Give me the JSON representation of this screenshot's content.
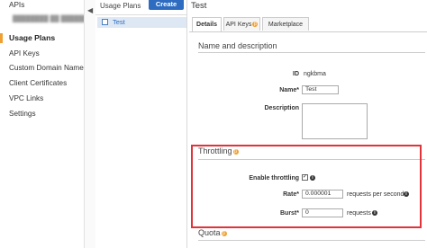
{
  "sidebar": {
    "items": [
      {
        "label": "APIs"
      },
      {
        "label": "Usage Plans"
      },
      {
        "label": "API Keys"
      },
      {
        "label": "Custom Domain Names"
      },
      {
        "label": "Client Certificates"
      },
      {
        "label": "VPC Links"
      },
      {
        "label": "Settings"
      }
    ]
  },
  "plans_panel": {
    "title": "Usage Plans",
    "create_label": "Create",
    "plans": [
      {
        "name": "Test"
      }
    ]
  },
  "main": {
    "title": "Test",
    "tabs": [
      {
        "label": "Details"
      },
      {
        "label": "API Keys"
      },
      {
        "label": "Marketplace"
      }
    ],
    "name_section": {
      "title": "Name and description",
      "id_label": "ID",
      "id_value": "ngkbma",
      "name_label": "Name*",
      "name_value": "Test",
      "description_label": "Description"
    },
    "throttling": {
      "title": "Throttling",
      "enable_label": "Enable throttling",
      "enabled": true,
      "rate_label": "Rate*",
      "rate_value": "0.000001",
      "rate_unit": "requests per second",
      "burst_label": "Burst*",
      "burst_value": "0",
      "burst_unit": "requests"
    },
    "quota": {
      "title": "Quota"
    }
  },
  "colors": {
    "accent": "#2d6cc0",
    "highlight": "#e0333a",
    "beta": "#f0a030"
  },
  "icons": {
    "beta": "beta-badge-icon",
    "info": "info-icon"
  }
}
